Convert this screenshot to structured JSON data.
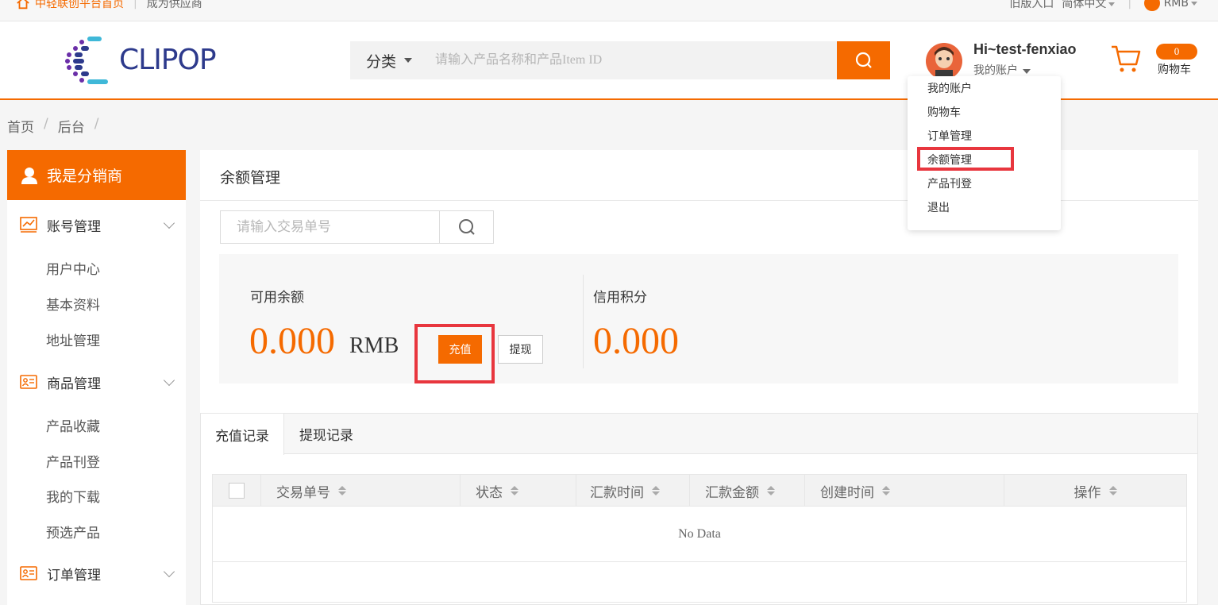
{
  "topbar": {
    "home_link": "中轻联创平台首页",
    "supplier": "成为供应商",
    "old_entry": "旧版入口",
    "language": "简体中文",
    "currency": "RMB"
  },
  "header": {
    "logo_text": "CLIPOP",
    "category_label": "分类",
    "search_placeholder": "请输入产品名称和产品Item ID",
    "greeting": "Hi~test-fenxiao",
    "my_account": "我的账户",
    "cart_count": "0",
    "cart_label": "购物车"
  },
  "dropdown": {
    "items": [
      "我的账户",
      "购物车",
      "订单管理",
      "余额管理",
      "产品刊登",
      "退出"
    ]
  },
  "breadcrumb": [
    "首页",
    "后台"
  ],
  "sidebar": {
    "header": "我是分销商",
    "groups": [
      {
        "label": "账号管理",
        "items": [
          "用户中心",
          "基本资料",
          "地址管理"
        ]
      },
      {
        "label": "商品管理",
        "items": [
          "产品收藏",
          "产品刊登",
          "我的下载",
          "预选产品"
        ]
      },
      {
        "label": "订单管理",
        "items": []
      }
    ]
  },
  "main": {
    "title": "余额管理",
    "tx_search_placeholder": "请输入交易单号",
    "available_label": "可用余额",
    "available_value": "0.000",
    "available_unit": "RMB",
    "recharge_label": "充值",
    "withdraw_label": "提现",
    "credit_label": "信用积分",
    "credit_value": "0.000",
    "tabs": [
      "充值记录",
      "提现记录"
    ],
    "table_headers": [
      "交易单号",
      "状态",
      "汇款时间",
      "汇款金额",
      "创建时间",
      "操作"
    ],
    "empty_text": "No Data"
  },
  "colors": {
    "accent": "#f56a00",
    "highlight": "#e8363e"
  }
}
